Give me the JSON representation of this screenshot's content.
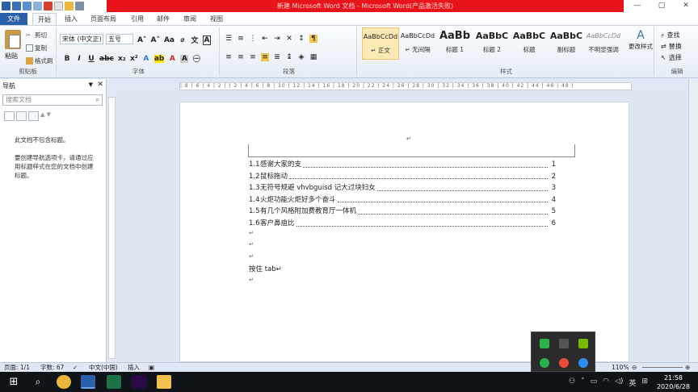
{
  "window": {
    "title": "新建 Microsoft Word 文档 - Microsoft Word(产品激活失败)",
    "min": "—",
    "max": "▢",
    "close": "✕"
  },
  "tabs": [
    "文件",
    "开始",
    "插入",
    "页面布局",
    "引用",
    "邮件",
    "审阅",
    "视图"
  ],
  "ribbon": {
    "clipboard": {
      "paste": "粘贴",
      "cut": "剪切",
      "copy": "复制",
      "format_painter": "格式刷",
      "label": "剪贴板"
    },
    "font": {
      "family": "宋体 (中文正)",
      "size": "五号",
      "label": "字体"
    },
    "paragraph": {
      "label": "段落"
    },
    "styles": {
      "items": [
        {
          "preview": "AaBbCcDd",
          "name": "↵ 正文"
        },
        {
          "preview": "AaBbCcDd",
          "name": "↵ 无间隔"
        },
        {
          "preview": "AaBb",
          "name": "标题 1"
        },
        {
          "preview": "AaBbC",
          "name": "标题 2"
        },
        {
          "preview": "AaBbC",
          "name": "标题"
        },
        {
          "preview": "AaBbC",
          "name": "副标题"
        },
        {
          "preview": "AaBbCcDd",
          "name": "不明显强调"
        }
      ],
      "change": "更改样式",
      "label": "样式"
    },
    "editing": {
      "find": "查找",
      "replace": "替换",
      "select": "选择",
      "label": "编辑"
    }
  },
  "nav": {
    "title": "导航",
    "search_placeholder": "搜索文档",
    "message": "此文档不包含标题。\n\n要创建导航选项卡，请通过应用标题样式在您的文档中创建标题。"
  },
  "ruler": "| 8 | 6 | 4 | 2 |   | 2 | 4 | 6 | 8 | 10 | 12 | 14 | 16 | 18 | 20 | 22 | 24 | 26 | 28 | 30 | 32 | 34 | 36 | 38 | 40 | 42 | 44 | 46 | 48 |",
  "toc": [
    {
      "num": "1.1",
      "text": "感谢大家的支",
      "page": "1"
    },
    {
      "num": "1.2",
      "text": "鼠标拖动",
      "page": "2"
    },
    {
      "num": "1.3",
      "text": "无符号规避 vhvbguisd 记大过块妇女",
      "page": "3"
    },
    {
      "num": "1.4",
      "text": "火炬功能火炬好多个奋斗",
      "page": "4"
    },
    {
      "num": "1.5",
      "text": "有几个风格附加费教育厅一体机",
      "page": "5"
    },
    {
      "num": "1.6",
      "text": "客户鼻疽比",
      "page": "6"
    }
  ],
  "body_text": "按住 tab↵",
  "para_mark": "↵",
  "status": {
    "page": "页面: 1/1",
    "words": "字数: 67",
    "lang": "中文(中国)",
    "mode": "插入",
    "zoom": "110%"
  },
  "taskbar": {
    "time": "21:58",
    "date": "2020/6/28",
    "ime": "英"
  }
}
